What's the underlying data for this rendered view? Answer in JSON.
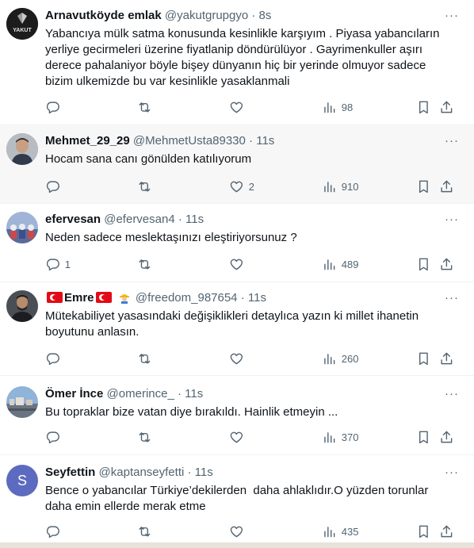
{
  "tweets": [
    {
      "name": "Arnavutköyde emlak",
      "handle": "@yakutgrupgyo",
      "time": "8s",
      "text": "Yabancıya mülk satma konusunda kesinlikle karşıyım . Piyasa yabancıların yerliye gecirmeleri üzerine fiyatlanip döndürülüyor . Gayrimenkuller aşırı derece pahalaniyor böyle bişey dünyanın hiç bir yerinde olmuyor sadece bizim ulkemizde bu var kesinlikle yasaklanmali",
      "avatar_label": "YAKUT",
      "replies": "",
      "retweets": "",
      "likes": "",
      "views": "98"
    },
    {
      "name": "Mehmet_29_29",
      "handle": "@MehmetUsta89330",
      "time": "11s",
      "text": "Hocam sana canı gönülden katılıyorum",
      "replies": "",
      "retweets": "",
      "likes": "2",
      "views": "910"
    },
    {
      "name": "efervesan",
      "handle": "@efervesan4",
      "time": "11s",
      "text": "Neden sadece meslektaşınızı eleştiriyorsunuz ?",
      "replies": "1",
      "retweets": "",
      "likes": "",
      "views": "489"
    },
    {
      "name": "Emre",
      "handle": "@freedom_987654",
      "time": "11s",
      "text": "Mütekabiliyet yasasındaki değişiklikleri detaylıca yazın ki millet ihanetin boyutunu anlasın.",
      "replies": "",
      "retweets": "",
      "likes": "",
      "views": "260"
    },
    {
      "name": "Ömer İnce",
      "handle": "@omerince_",
      "time": "11s",
      "text": "Bu topraklar bize vatan diye bırakıldı. Hainlik etmeyin ...",
      "replies": "",
      "retweets": "",
      "likes": "",
      "views": "370"
    },
    {
      "name": "Seyfettin",
      "handle": "@kaptanseyfetti",
      "time": "11s",
      "text": "Bence o yabancılar Türkiye’dekilerden  daha ahlaklıdır.O yüzden torunlar daha emin ellerde merak etme",
      "avatar_letter": "S",
      "replies": "",
      "retweets": "",
      "likes": "",
      "views": "435"
    }
  ],
  "ui": {
    "dot": "·",
    "more": "···"
  },
  "colors": {
    "text": "#0f1419",
    "secondary": "#536471",
    "border": "#eff3f4",
    "highlight": "#f7f7f7",
    "avatar_s": "#5c6bc0"
  }
}
